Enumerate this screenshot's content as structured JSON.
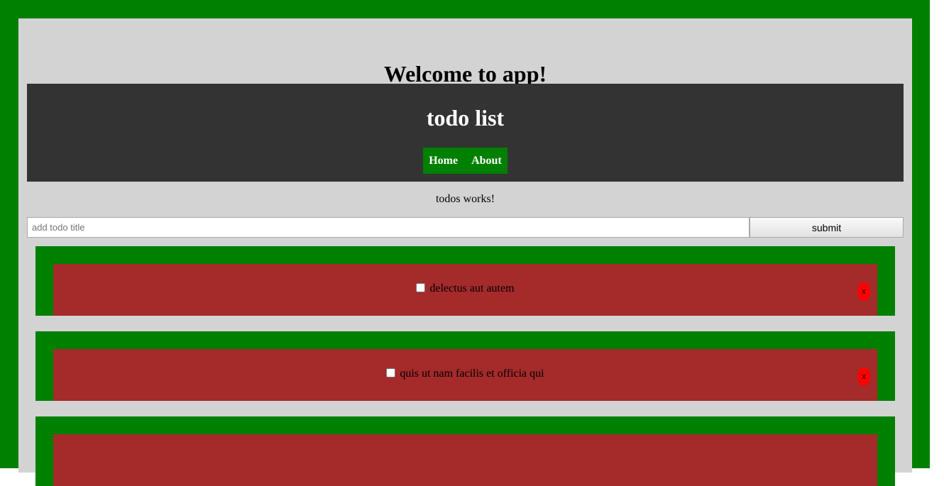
{
  "app": {
    "title": "Welcome to app!"
  },
  "header": {
    "title": "todo list",
    "nav": [
      {
        "label": "Home"
      },
      {
        "label": "About"
      }
    ]
  },
  "todos_status": "todos works!",
  "form": {
    "placeholder": "add todo title",
    "input_value": "",
    "submit_label": "submit"
  },
  "todos": [
    {
      "title": "delectus aut autem",
      "completed": false,
      "delete_label": "x"
    },
    {
      "title": "quis ut nam facilis et officia qui",
      "completed": false,
      "delete_label": "x"
    },
    {
      "title": "",
      "completed": false,
      "delete_label": ""
    }
  ],
  "colors": {
    "frame": "#008000",
    "page_bg": "#d3d3d3",
    "header_bg": "#333333",
    "nav_bg": "#008000",
    "todo_card": "#008000",
    "todo_body": "#a52a2a",
    "delete_button": "#ff0000"
  }
}
